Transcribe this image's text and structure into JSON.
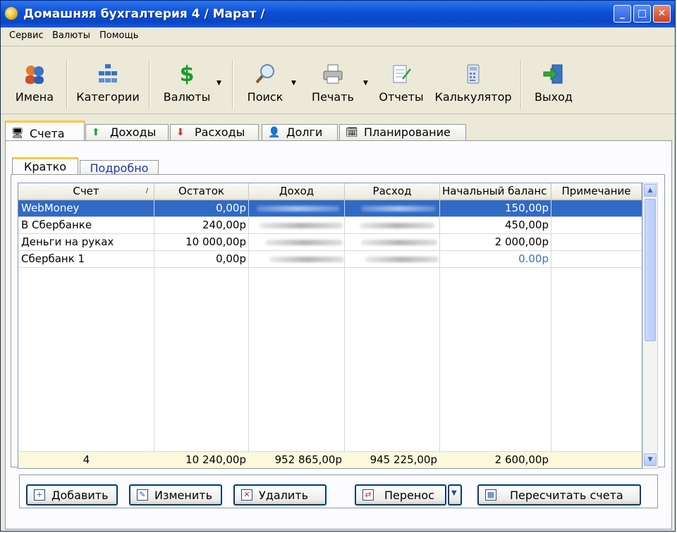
{
  "window": {
    "title": "Домашняя бухгалтерия 4  / Марат /"
  },
  "menu": [
    "Сервис",
    "Валюты",
    "Помощь"
  ],
  "toolbar": [
    {
      "label": "Имена",
      "icon": "people-icon"
    },
    {
      "label": "Категории",
      "icon": "categories-icon"
    },
    {
      "label": "Валюты",
      "icon": "dollar-icon"
    },
    {
      "label": "Поиск",
      "icon": "magnifier-icon"
    },
    {
      "label": "Печать",
      "icon": "printer-icon"
    },
    {
      "label": "Отчеты",
      "icon": "report-icon"
    },
    {
      "label": "Калькулятор",
      "icon": "calculator-icon"
    },
    {
      "label": "Выход",
      "icon": "exit-door-icon"
    }
  ],
  "main_tabs": [
    "Счета",
    "Доходы",
    "Расходы",
    "Долги",
    "Планирование"
  ],
  "sub_tabs": [
    "Кратко",
    "Подробно"
  ],
  "table": {
    "columns": [
      "Счет",
      "Остаток",
      "Доход",
      "Расход",
      "Начальный баланс",
      "Примечание"
    ],
    "rows": [
      {
        "account": "WebMoney",
        "balance": "0,00р",
        "initial": "150,00р"
      },
      {
        "account": "В Сбербанке",
        "balance": "240,00р",
        "initial": "450,00р"
      },
      {
        "account": "Деньги на руках",
        "balance": "10 000,00р",
        "initial": "2 000,00р"
      },
      {
        "account": "Сбербанк 1",
        "balance": "0,00р",
        "initial": "0.00р"
      }
    ],
    "totals": {
      "count": "4",
      "balance": "10 240,00р",
      "income": "952 865,00р",
      "expense": "945 225,00р",
      "initial": "2 600,00р"
    }
  },
  "buttons": [
    "Добавить",
    "Изменить",
    "Удалить",
    "Перенос",
    "Пересчитать счета"
  ],
  "colors": {
    "selection": "#316ac5",
    "titlebar": "#0b4fd6",
    "accent_tab": "#ffc83c",
    "link_value": "#3a6ec9"
  }
}
